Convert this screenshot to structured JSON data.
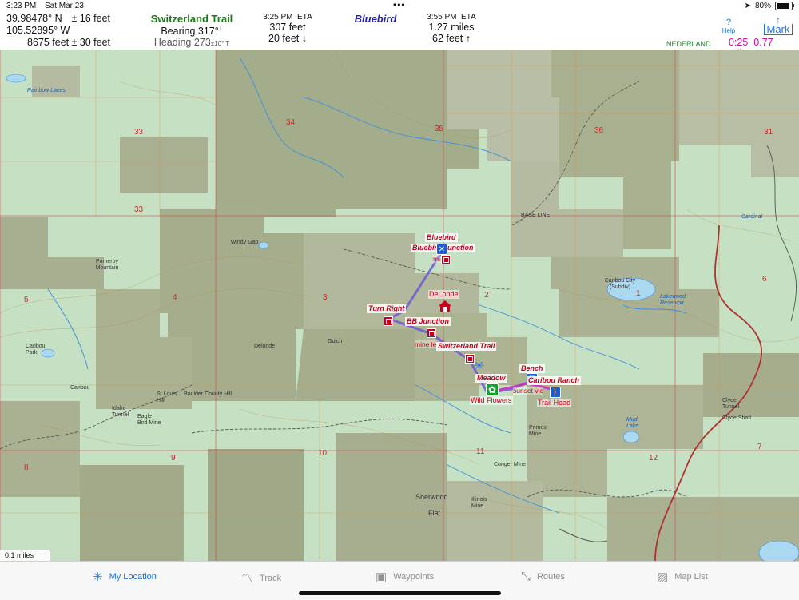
{
  "status_bar": {
    "time": "3:23 PM",
    "date": "Sat Mar 23",
    "battery": "80%"
  },
  "header": {
    "lat": "39.98478° N",
    "lon": "105.52895° W",
    "elev": "8675 feet",
    "horiz_acc": "± 16 feet",
    "vert_acc": "± 30 feet",
    "target_trail": "Switzerland Trail",
    "bearing_label": "Bearing",
    "bearing_value": "317°",
    "bearing_sup": "T",
    "heading_label": "Heading",
    "heading_value": "273",
    "heading_sup": "±10° T",
    "eta1_time": "3:25 PM",
    "eta_label": "ETA",
    "eta1_dist": "307 feet",
    "eta1_elev": "20 feet ↓",
    "target2": "Bluebird",
    "eta2_time": "3:55 PM",
    "eta2_dist": "1.27 miles",
    "eta2_elev": "62 feet ↑",
    "help_label": "Help",
    "mark_label": "Mark",
    "map_name": "NEDERLAND",
    "trip_time": "0:25",
    "trip_dist": "0.77 miles"
  },
  "map": {
    "scale": "0.1 miles",
    "waypoints": {
      "bluebird": "Bluebird",
      "bluebird_junction": "Bluebird Junction",
      "delonde": "DeLonde",
      "turn_right": "Turn Right",
      "bb_junction": "BB Junction",
      "mine_left": "mine le",
      "switzerland_trail": "Switzerland Trail",
      "meadow": "Meadow",
      "wild_flowers": "Wild Flowers",
      "bench": "Bench",
      "caribou_ranch": "Caribou Ranch",
      "sunset_view": "sunset vie",
      "trail_head": "Trail Head",
      "mine_small": "mi"
    },
    "place_labels": {
      "rainbow_lakes": "Rainbow Lakes",
      "windy_gap": "Windy Gap",
      "pomeroy": "Pomeroy Mountain",
      "delonde_gulch": "Delonde",
      "gulch": "Gulch",
      "caribou_city": "Caribou City (Subdiv)",
      "caribou_park": "Caribou Park",
      "caribou": "Caribou",
      "boulder_county_hill": "Boulder County Hill",
      "st_louis": "St Louis Hill",
      "idaho_tunnel": "Idaho Tunnel",
      "eagle_bird": "Eagle Bird Mine",
      "sherwood": "Sherwood",
      "flat": "Flat",
      "illinois": "Illinois Mine",
      "conger": "Conger Mine",
      "primos": "Primos Mine",
      "clyde_tunnel": "Clyde Tunnel",
      "clyde_shaft": "Clyde Shaft",
      "lakewood": "Lakewood Reservoir",
      "mud_lake": "Mud Lake",
      "base_line": "BASE LINE",
      "cardinal": "Cardinal"
    },
    "sections": [
      "33",
      "34",
      "35",
      "36",
      "31",
      "4",
      "3",
      "2",
      "1",
      "6",
      "5",
      "9",
      "10",
      "11",
      "12",
      "7",
      "8",
      "33"
    ]
  },
  "tabs": [
    {
      "label": "My Location",
      "icon": "my-location-icon"
    },
    {
      "label": "Track",
      "icon": "track-icon"
    },
    {
      "label": "Waypoints",
      "icon": "waypoints-icon"
    },
    {
      "label": "Routes",
      "icon": "routes-icon"
    },
    {
      "label": "Map List",
      "icon": "map-list-icon"
    }
  ],
  "colors": {
    "waypoint_red": "#c8001e",
    "route_blue": "#6d5bd6",
    "route_magenta": "#c932c0",
    "accent": "#1a73e8",
    "trail_green": "#1a7a1a"
  }
}
